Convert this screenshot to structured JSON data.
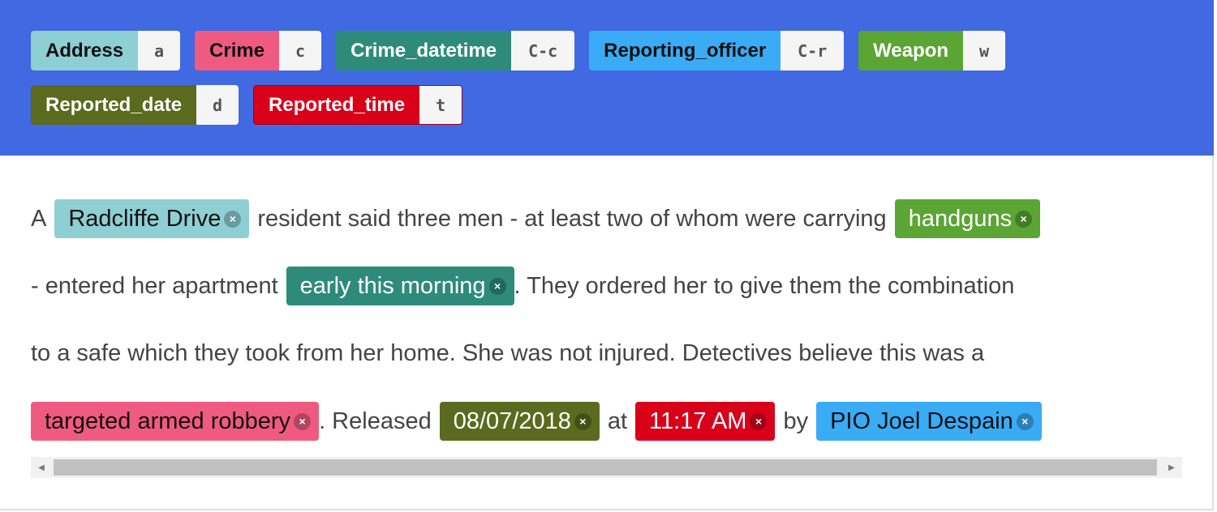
{
  "labels": [
    {
      "name": "Address",
      "key": "a",
      "bg": "#8ecfd3",
      "fg": "#111"
    },
    {
      "name": "Crime",
      "key": "c",
      "bg": "#ef5b80",
      "fg": "#111"
    },
    {
      "name": "Crime_datetime",
      "key": "C-c",
      "bg": "#2e8b7a",
      "fg": "#fff"
    },
    {
      "name": "Reporting_officer",
      "key": "C-r",
      "bg": "#3aabf5",
      "fg": "#111"
    },
    {
      "name": "Weapon",
      "key": "w",
      "bg": "#5aa534",
      "fg": "#fff"
    },
    {
      "name": "Reported_date",
      "key": "d",
      "bg": "#5b6a1e",
      "fg": "#fff"
    },
    {
      "name": "Reported_time",
      "key": "t",
      "bg": "#d9001a",
      "fg": "#fff"
    }
  ],
  "text": {
    "t1": "A",
    "tag_address": "Radcliffe Drive",
    "t2": "resident said three men - at least two of whom were carrying",
    "tag_weapon": "handguns",
    "t3": "- entered her apartment",
    "tag_datetime": "early this morning",
    "t4": ". They ordered her to give them the combination",
    "t5": "to a safe which they took from her home. She was not injured. Detectives believe this was a",
    "tag_crime": "targeted armed robbery",
    "t6": ". Released",
    "tag_date": "08/07/2018",
    "t7": "at",
    "tag_time": "11:17 AM",
    "t8": "by",
    "tag_officer": "PIO Joel Despain",
    "close": "×"
  },
  "scrollbar": {
    "left_arrow": "◀",
    "right_arrow": "▶"
  }
}
